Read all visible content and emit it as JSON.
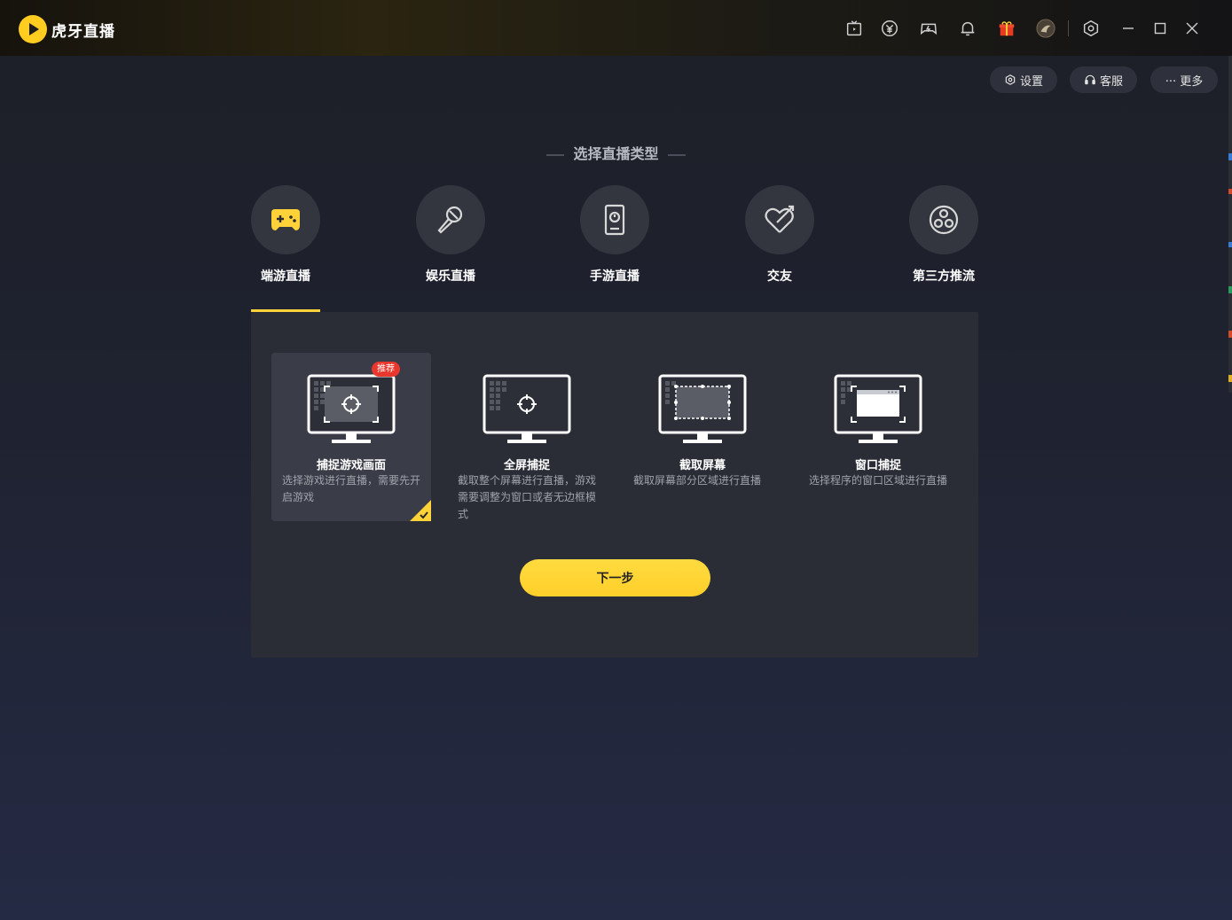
{
  "app": {
    "title": "虎牙直播"
  },
  "titlebar": {
    "icons": [
      "tv-icon",
      "yuan-coin-icon",
      "game-controller-icon",
      "bell-icon",
      "gift-icon",
      "avatar",
      "settings-hex-icon"
    ],
    "window_controls": [
      "minimize-icon",
      "maximize-icon",
      "close-icon"
    ]
  },
  "toolbar": {
    "settings_label": "设置",
    "service_label": "客服",
    "more_label": "··· 更多"
  },
  "section": {
    "title": "选择直播类型"
  },
  "types": [
    {
      "label": "端游直播",
      "icon": "gamepad-icon",
      "active": true
    },
    {
      "label": "娱乐直播",
      "icon": "microphone-icon",
      "active": false
    },
    {
      "label": "手游直播",
      "icon": "phone-icon",
      "active": false
    },
    {
      "label": "交友",
      "icon": "heart-arrow-icon",
      "active": false
    },
    {
      "label": "第三方推流",
      "icon": "obs-icon",
      "active": false
    }
  ],
  "capture_modes": [
    {
      "title": "捕捉游戏画面",
      "desc": "选择游戏进行直播，需要先开启游戏",
      "badge": "推荐",
      "selected": true
    },
    {
      "title": "全屏捕捉",
      "desc": "截取整个屏幕进行直播，游戏需要调整为窗口或者无边框模式",
      "selected": false
    },
    {
      "title": "截取屏幕",
      "desc": "截取屏幕部分区域进行直播",
      "selected": false
    },
    {
      "title": "窗口捕捉",
      "desc": "选择程序的窗口区域进行直播",
      "selected": false
    }
  ],
  "next_button": {
    "label": "下一步"
  },
  "colors": {
    "accent": "#ffd23a",
    "badge": "#e8372c",
    "panel": "#2a2c36"
  }
}
